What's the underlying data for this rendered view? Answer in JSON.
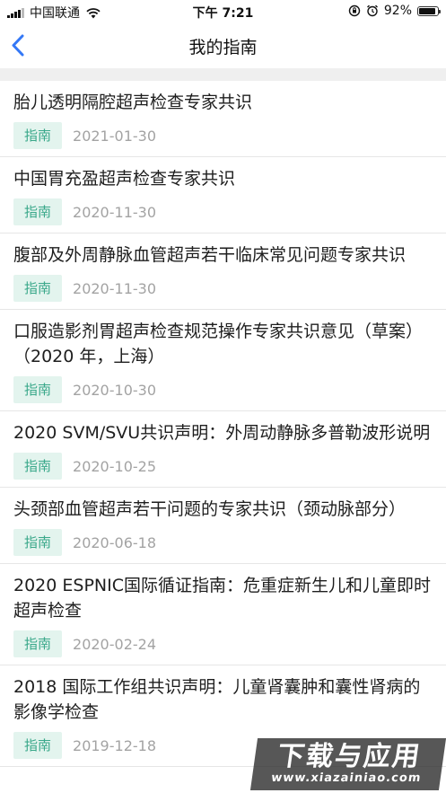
{
  "status_bar": {
    "carrier": "中国联通",
    "time": "下午 7:21",
    "battery": "92%",
    "battery_level": 0.92
  },
  "nav": {
    "title": "我的指南"
  },
  "items": [
    {
      "title": "胎儿透明隔腔超声检查专家共识",
      "tag": "指南",
      "date": "2021-01-30"
    },
    {
      "title": "中国胃充盈超声检查专家共识",
      "tag": "指南",
      "date": "2020-11-30"
    },
    {
      "title": "腹部及外周静脉血管超声若干临床常见问题专家共识",
      "tag": "指南",
      "date": "2020-11-30"
    },
    {
      "title": "口服造影剂胃超声检查规范操作专家共识意见（草案）（2020 年，上海）",
      "tag": "指南",
      "date": "2020-10-30"
    },
    {
      "title": "2020 SVM/SVU共识声明：外周动静脉多普勒波形说明",
      "tag": "指南",
      "date": "2020-10-25"
    },
    {
      "title": "头颈部血管超声若干问题的专家共识（颈动脉部分）",
      "tag": "指南",
      "date": "2020-06-18"
    },
    {
      "title": "2020 ESPNIC国际循证指南：危重症新生儿和儿童即时超声检查",
      "tag": "指南",
      "date": "2020-02-24"
    },
    {
      "title": "2018 国际工作组共识声明：儿童肾囊肿和囊性肾病的影像学检查",
      "tag": "指南",
      "date": "2019-12-18"
    }
  ],
  "watermark": {
    "main": "下载与应用",
    "sub": "www.xiazainiao.com"
  },
  "colors": {
    "tag_bg": "#e3f4ee",
    "tag_text": "#3aa88a",
    "back_arrow": "#3478f6",
    "date": "#a3a3a3"
  }
}
